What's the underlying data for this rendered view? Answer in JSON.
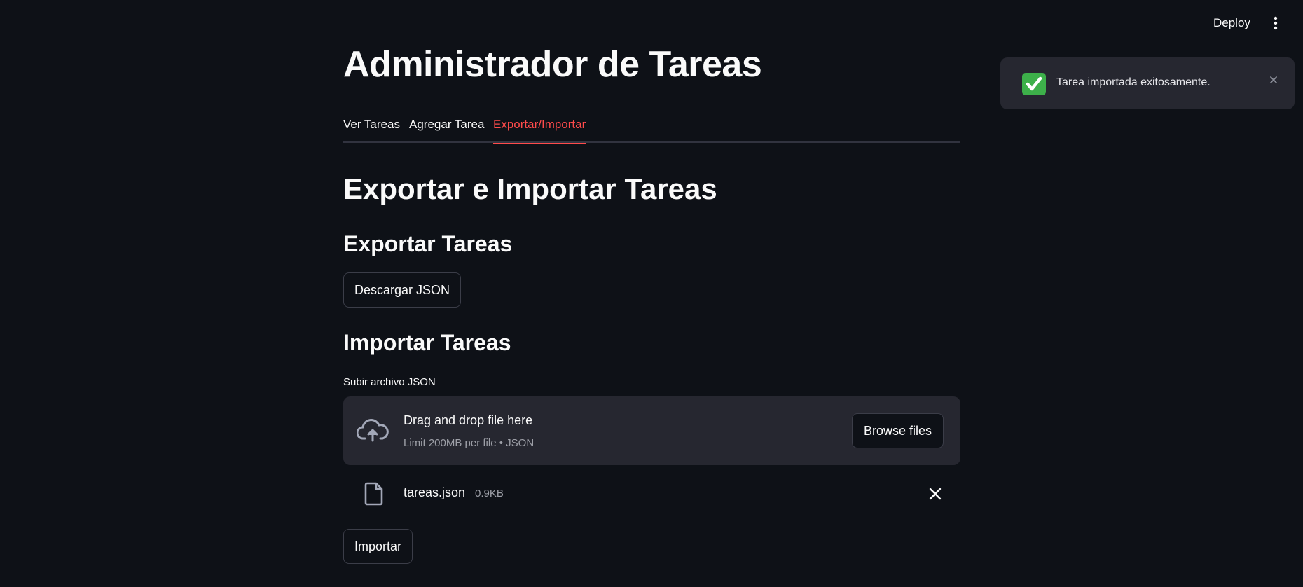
{
  "header": {
    "deploy_label": "Deploy",
    "menu_icon": "kebab-menu-icon"
  },
  "page": {
    "title": "Administrador de Tareas"
  },
  "tabs": [
    {
      "label": "Ver Tareas",
      "active": false
    },
    {
      "label": "Agregar Tarea",
      "active": false
    },
    {
      "label": "Exportar/Importar",
      "active": true
    }
  ],
  "section": {
    "title": "Exportar e Importar Tareas",
    "export": {
      "title": "Exportar Tareas",
      "button_label": "Descargar JSON"
    },
    "import": {
      "title": "Importar Tareas",
      "uploader_label": "Subir archivo JSON",
      "drop_text": "Drag and drop file here",
      "drop_limit": "Limit 200MB per file • JSON",
      "browse_label": "Browse files",
      "file": {
        "name": "tareas.json",
        "size": "0.9KB"
      },
      "button_label": "Importar"
    }
  },
  "toast": {
    "message": "Tarea importada exitosamente.",
    "icon": "check-mark-icon"
  },
  "colors": {
    "background": "#0e1117",
    "accent": "#ff4b4b",
    "surface": "#262730",
    "success": "#3db04a"
  }
}
